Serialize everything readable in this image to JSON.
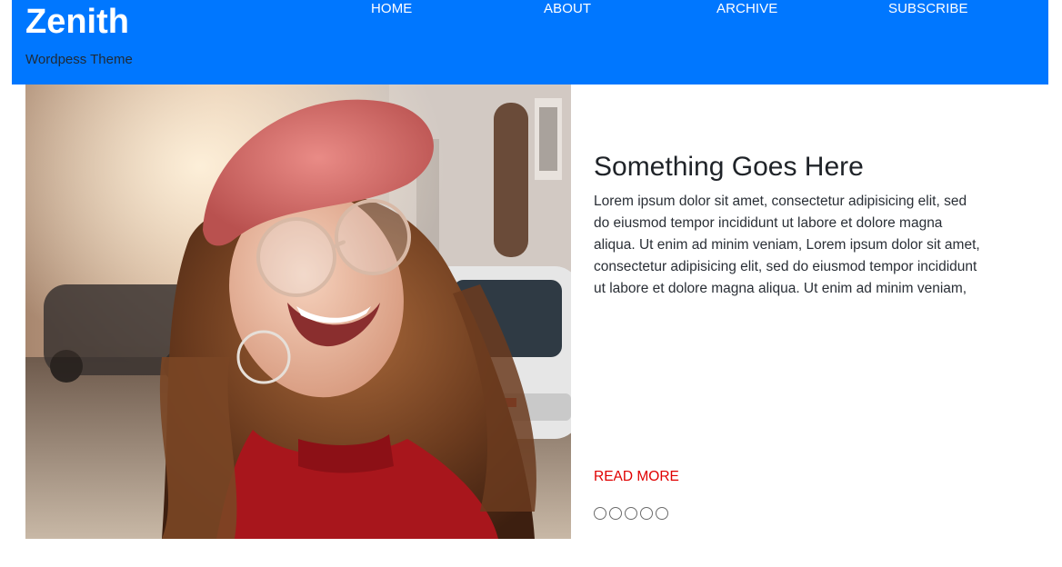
{
  "site": {
    "title": "Zenith",
    "tagline": "Wordpess Theme"
  },
  "nav": {
    "items": [
      {
        "label": "HOME"
      },
      {
        "label": "ABOUT"
      },
      {
        "label": "ARCHIVE"
      },
      {
        "label": "SUBSCRIBE"
      }
    ]
  },
  "slide": {
    "title": "Something Goes Here",
    "excerpt": "Lorem ipsum dolor sit amet, consectetur adipisicing elit, sed do eiusmod tempor incididunt ut labore et dolore magna aliqua. Ut enim ad minim veniam, Lorem ipsum dolor sit amet, consectetur adipisicing elit, sed do eiusmod tempor incididunt ut labore et dolore magna aliqua. Ut enim ad minim veniam,",
    "read_more": "READ MORE",
    "dot_count": 5
  },
  "colors": {
    "header_bg": "#0077ff",
    "read_more": "#e00000"
  }
}
